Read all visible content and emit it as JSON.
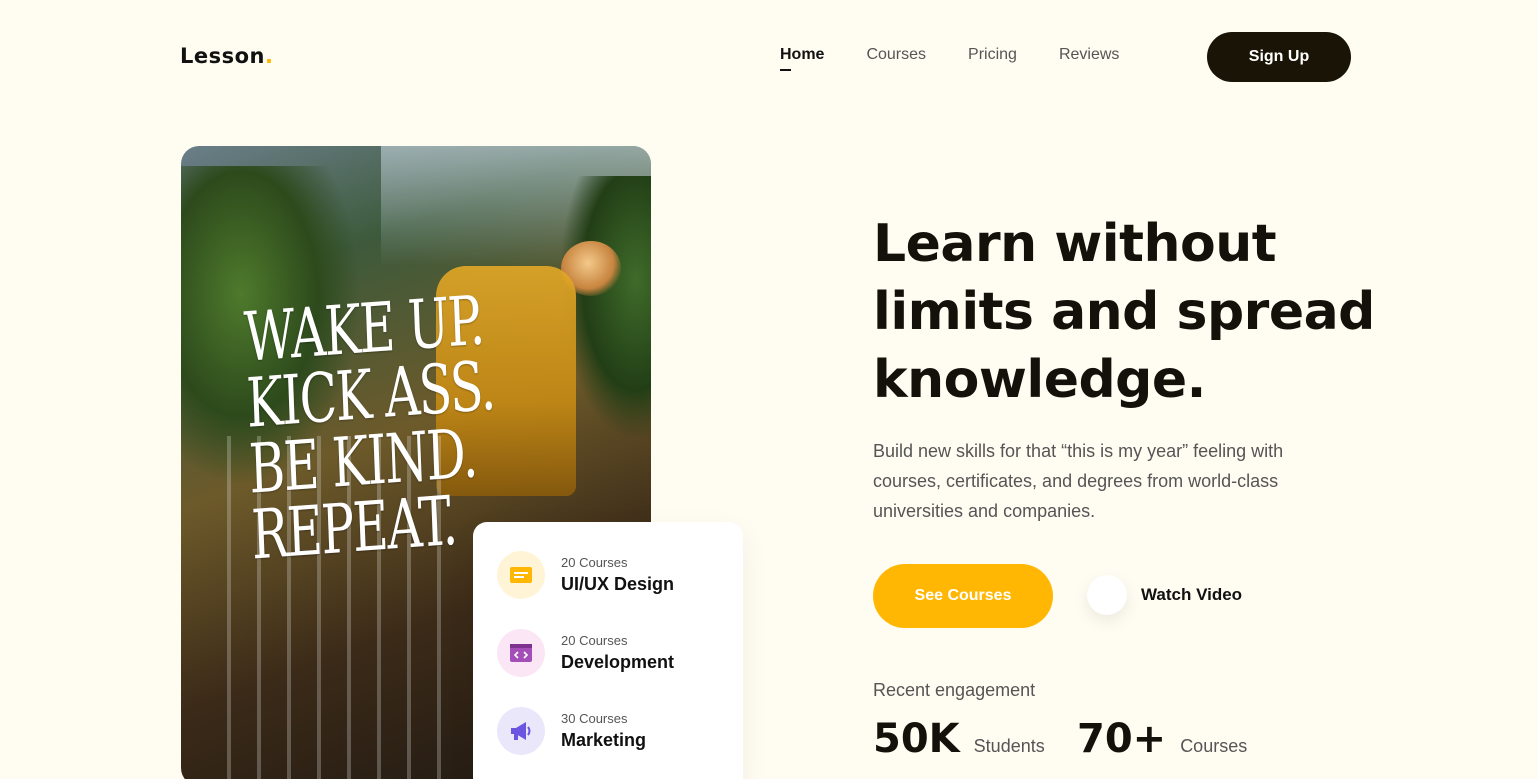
{
  "brand": {
    "name": "Lesson",
    "dot": ".",
    "accent": "#ffb703"
  },
  "nav": {
    "items": [
      {
        "label": "Home",
        "active": true
      },
      {
        "label": "Courses",
        "active": false
      },
      {
        "label": "Pricing",
        "active": false
      },
      {
        "label": "Reviews",
        "active": false
      }
    ],
    "signup_label": "Sign Up"
  },
  "hero_image": {
    "text_lines": [
      "WAKE UP.",
      "KICK ASS.",
      "BE KIND.",
      "REPEAT."
    ]
  },
  "categories": [
    {
      "count": "20 Courses",
      "name": "UI/UX Design",
      "icon": "ui-ux-design-icon",
      "bg": "#fff4d6",
      "color": "#ffb703"
    },
    {
      "count": "20 Courses",
      "name": "Development",
      "icon": "code-window-icon",
      "bg": "#fbe6f5",
      "color": "#a44fb7"
    },
    {
      "count": "30 Courses",
      "name": "Marketing",
      "icon": "megaphone-icon",
      "bg": "#eae7fb",
      "color": "#6b54e0"
    }
  ],
  "hero": {
    "title": "Learn without limits and spread knowledge.",
    "subtitle": "Build new skills for that “this is my year” feeling with courses, certificates, and degrees from world-class universities and companies.",
    "primary_cta": "See Courses",
    "secondary_cta": "Watch Video"
  },
  "engagement": {
    "label": "Recent engagement",
    "stats": [
      {
        "value": "50K",
        "label": "Students"
      },
      {
        "value": "70+",
        "label": "Courses"
      }
    ]
  },
  "colors": {
    "background": "#fffcf2",
    "dark": "#1a1406",
    "accent": "#ffb703"
  }
}
